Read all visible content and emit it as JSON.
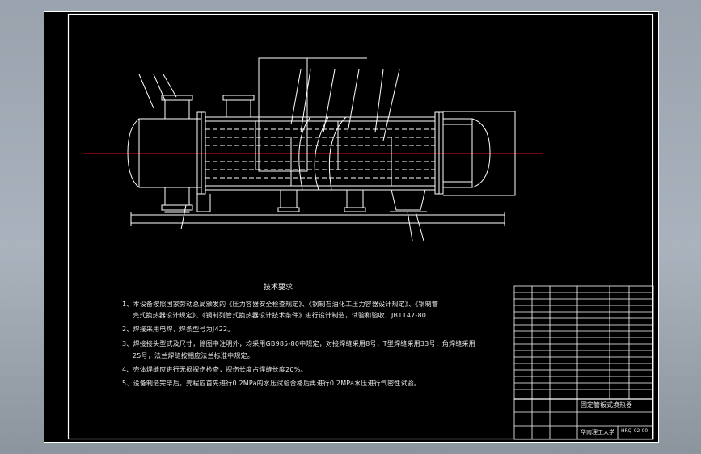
{
  "technical_requirements": {
    "title": "技术要求",
    "lines": [
      "1、本设备按照国家劳动总局颁发的《压力容器安全检查规定》、《钢制石油化工压力容器设计规定》、《钢制管",
      "壳式换热器设计规定》、《钢制列管式换热器设计技术条件》进行设计制造，试验和验收，JB1147-80",
      "2、焊接采用电焊，焊条型号为J422。",
      "3、焊接接头型式及尺寸，除图中注明外，均采用GB985-80中规定，对接焊缝采用8号，T型焊缝采用33号，角焊缝采用",
      "25号，法兰焊缝按相应法兰标准中规定。",
      "4、壳体焊缝应进行无损探伤检查，探伤长度占焊缝长度20%。",
      "5、设备制造完毕后，壳程应首先进行0.2MPa的水压试验合格后再进行0.2MPa水压进行气密性试验。"
    ]
  },
  "title_block": {
    "drawing_title": "固定管板式换热器",
    "school": "华南理工大学",
    "drawing_no": "HRQ-02-00"
  },
  "colors": {
    "line": "#ffffff",
    "centerline": "#e01010",
    "background": "#000000"
  }
}
